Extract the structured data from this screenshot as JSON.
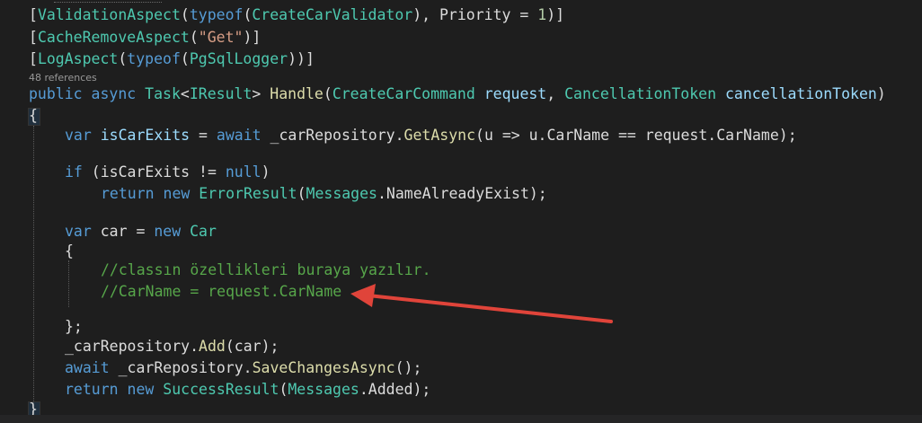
{
  "editor": {
    "codelens": "48 references",
    "lines": {
      "attr1": {
        "open": "[",
        "name": "ValidationAspect",
        "p1": "(",
        "kw": "typeof",
        "p2": "(",
        "type": "CreateCarValidator",
        "p3": "), Priority = ",
        "num": "1",
        "close": ")]"
      },
      "attr2": {
        "open": "[",
        "name": "CacheRemoveAspect",
        "p1": "(",
        "str": "\"Get\"",
        "close": ")]"
      },
      "attr3": {
        "open": "[",
        "name": "LogAspect",
        "p1": "(",
        "kw": "typeof",
        "p2": "(",
        "type": "PgSqlLogger",
        "close": "))]"
      },
      "signature": {
        "kw1": "public",
        "kw2": "async",
        "type1": "Task",
        "lt": "<",
        "type2": "IResult",
        "gt": ">",
        "method": "Handle",
        "p1": "(",
        "type3": "CreateCarCommand",
        "param1": "request",
        "comma": ", ",
        "type4": "CancellationToken",
        "param2": "cancellationToken",
        "close": ")"
      },
      "brace_open": "{",
      "var1": {
        "kw1": "var",
        "name": "isCarExits",
        "eq": " = ",
        "kw2": "await",
        "rest1": " _carRepository.",
        "method": "GetAsync",
        "rest2": "(u => u.CarName == request.CarName);"
      },
      "if_line": {
        "kw": "if",
        "rest1": " (isCarExits != ",
        "kw2": "null",
        "rest2": ")"
      },
      "return1": {
        "kw": "return",
        "kw2": "new",
        "type": "ErrorResult",
        "p1": "(",
        "type2": "Messages",
        "rest": ".NameAlreadyExist);"
      },
      "var2": {
        "kw1": "var",
        "rest1": " car = ",
        "kw2": "new",
        "type": "Car"
      },
      "inner_open": "{",
      "comment1": "//classın özellikleri buraya yazılır.",
      "comment2": "//CarName = request.CarName",
      "inner_close": "};",
      "add_line": {
        "rest1": "_carRepository.",
        "method": "Add",
        "rest2": "(car);"
      },
      "save_line": {
        "kw": "await",
        "rest1": " _carRepository.",
        "method": "SaveChangesAsync",
        "rest2": "();"
      },
      "return2": {
        "kw": "return",
        "kw2": "new",
        "type": "SuccessResult",
        "p1": "(",
        "type2": "Messages",
        "rest": ".Added);"
      },
      "brace_close": "}"
    }
  },
  "annotation": {
    "arrow_color": "#e0443a"
  },
  "theme": {
    "background": "#1e1e1e",
    "keyword": "#569cd6",
    "type": "#4ec9b0",
    "string": "#d69d85",
    "comment": "#57a64a",
    "method": "#dcdcaa",
    "text": "#dcdcdc"
  }
}
